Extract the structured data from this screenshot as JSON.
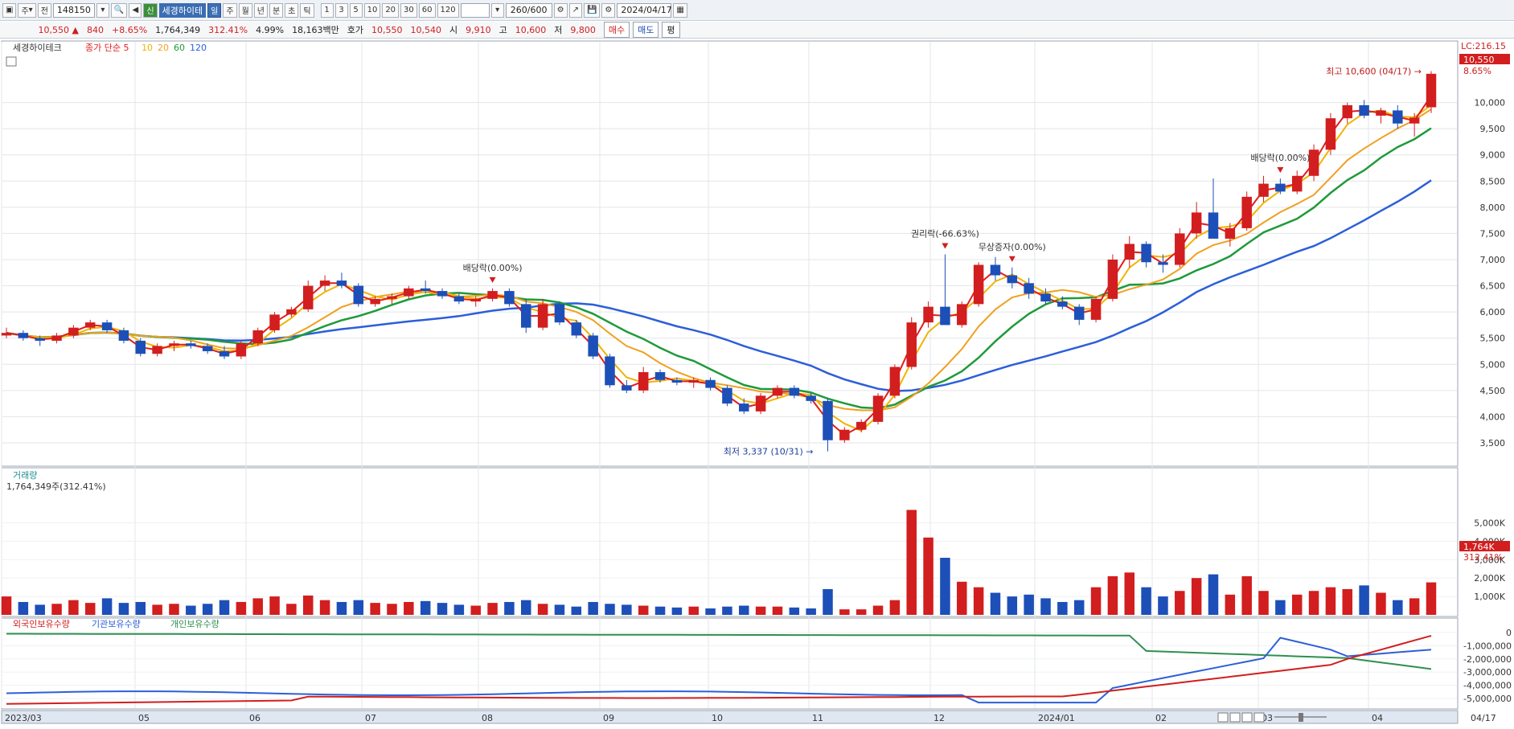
{
  "toolbar": {
    "period": "주",
    "mode": "전",
    "code": "148150",
    "name": "세경하이테",
    "tf_labels": [
      "일",
      "주",
      "월",
      "년",
      "분",
      "초",
      "틱"
    ],
    "tf_selected": "일",
    "num_labels": [
      "1",
      "3",
      "5",
      "10",
      "20",
      "30",
      "60",
      "120"
    ],
    "count": "260/600",
    "date": "2024/04/17"
  },
  "quote": {
    "price": "10,550 ▲",
    "change": "840",
    "change_pct": "+8.65%",
    "volume": "1,764,349",
    "volume_pct": "312.41%",
    "turnover_pct": "4.99%",
    "amount": "18,163백만",
    "hoga_label": "호가",
    "ask": "10,550",
    "bid": "10,540",
    "open_label": "시",
    "open": "9,910",
    "high_label": "고",
    "high": "10,600",
    "low_label": "저",
    "low": "9,800",
    "buy_btn": "매수",
    "sell_btn": "매도",
    "eval_btn": "평"
  },
  "colors": {
    "up": "#d21e1e",
    "down": "#1d4fb8",
    "ma5": "#e31c1c",
    "ma10": "#f0b400",
    "ma20": "#f0a020",
    "ma60": "#1f9a3a",
    "ma120": "#2c5fd8",
    "foreign": "#d21e1e",
    "institution": "#2c5fd8",
    "individual": "#2f8f4f"
  },
  "chart_data": [
    {
      "type": "line",
      "title": "세경하이테크",
      "legend": [
        "종가 단순 5",
        "10",
        "20",
        "60",
        "120"
      ],
      "x_ticks": [
        "2023/03",
        "05",
        "06",
        "07",
        "08",
        "09",
        "10",
        "11",
        "12",
        "2024/01",
        "02",
        "03",
        "04",
        "04/17"
      ],
      "ylim": [
        3100,
        10900
      ],
      "y_ticks": [
        "3,500",
        "4,000",
        "4,500",
        "5,000",
        "5,500",
        "6,000",
        "6,500",
        "7,000",
        "7,500",
        "8,000",
        "8,500",
        "9,000",
        "9,500",
        "10,000"
      ],
      "candles": [
        [
          5550,
          5700,
          5500,
          5600
        ],
        [
          5600,
          5650,
          5450,
          5500
        ],
        [
          5500,
          5550,
          5350,
          5450
        ],
        [
          5450,
          5600,
          5400,
          5550
        ],
        [
          5550,
          5750,
          5500,
          5700
        ],
        [
          5700,
          5850,
          5650,
          5800
        ],
        [
          5800,
          5850,
          5600,
          5650
        ],
        [
          5650,
          5700,
          5400,
          5450
        ],
        [
          5450,
          5500,
          5150,
          5200
        ],
        [
          5200,
          5400,
          5150,
          5350
        ],
        [
          5350,
          5450,
          5250,
          5400
        ],
        [
          5400,
          5450,
          5300,
          5350
        ],
        [
          5350,
          5400,
          5200,
          5250
        ],
        [
          5250,
          5350,
          5100,
          5150
        ],
        [
          5150,
          5450,
          5100,
          5400
        ],
        [
          5400,
          5700,
          5350,
          5650
        ],
        [
          5650,
          6000,
          5600,
          5950
        ],
        [
          5950,
          6100,
          5900,
          6050
        ],
        [
          6050,
          6600,
          6000,
          6500
        ],
        [
          6500,
          6700,
          6400,
          6600
        ],
        [
          6600,
          6750,
          6450,
          6500
        ],
        [
          6500,
          6550,
          6100,
          6150
        ],
        [
          6150,
          6300,
          6100,
          6250
        ],
        [
          6250,
          6350,
          6150,
          6300
        ],
        [
          6300,
          6500,
          6250,
          6450
        ],
        [
          6450,
          6600,
          6350,
          6400
        ],
        [
          6400,
          6450,
          6250,
          6300
        ],
        [
          6300,
          6350,
          6150,
          6200
        ],
        [
          6200,
          6300,
          6100,
          6250
        ],
        [
          6250,
          6450,
          6200,
          6400
        ],
        [
          6400,
          6450,
          6100,
          6150
        ],
        [
          6150,
          6250,
          5600,
          5700
        ],
        [
          5700,
          6250,
          5650,
          6150
        ],
        [
          6150,
          6200,
          5750,
          5800
        ],
        [
          5800,
          5850,
          5500,
          5550
        ],
        [
          5550,
          5600,
          5100,
          5150
        ],
        [
          5150,
          5200,
          4550,
          4600
        ],
        [
          4600,
          4700,
          4450,
          4500
        ],
        [
          4500,
          4950,
          4450,
          4850
        ],
        [
          4850,
          4900,
          4650,
          4700
        ],
        [
          4700,
          4750,
          4600,
          4650
        ],
        [
          4650,
          4750,
          4550,
          4700
        ],
        [
          4700,
          4750,
          4500,
          4550
        ],
        [
          4550,
          4600,
          4200,
          4250
        ],
        [
          4250,
          4350,
          4050,
          4100
        ],
        [
          4100,
          4450,
          4050,
          4400
        ],
        [
          4400,
          4600,
          4350,
          4550
        ],
        [
          4550,
          4600,
          4350,
          4400
        ],
        [
          4400,
          4450,
          4250,
          4300
        ],
        [
          4300,
          4350,
          3337,
          3550
        ],
        [
          3550,
          3800,
          3500,
          3750
        ],
        [
          3750,
          3950,
          3700,
          3900
        ],
        [
          3900,
          4450,
          3850,
          4400
        ],
        [
          4400,
          5000,
          4350,
          4950
        ],
        [
          4950,
          5900,
          4900,
          5800
        ],
        [
          5800,
          6200,
          5700,
          6100
        ],
        [
          6100,
          7100,
          5950,
          5750
        ],
        [
          5750,
          6200,
          5700,
          6150
        ],
        [
          6150,
          6950,
          6100,
          6900
        ],
        [
          6900,
          7050,
          6600,
          6700
        ],
        [
          6700,
          6850,
          6450,
          6550
        ],
        [
          6550,
          6650,
          6250,
          6350
        ],
        [
          6350,
          6450,
          6150,
          6200
        ],
        [
          6200,
          6300,
          6050,
          6100
        ],
        [
          6100,
          6150,
          5750,
          5850
        ],
        [
          5850,
          6300,
          5800,
          6250
        ],
        [
          6250,
          7100,
          6200,
          7000
        ],
        [
          7000,
          7450,
          6850,
          7300
        ],
        [
          7300,
          7350,
          6850,
          6950
        ],
        [
          6950,
          7100,
          6750,
          6900
        ],
        [
          6900,
          7600,
          6850,
          7500
        ],
        [
          7500,
          8100,
          7400,
          7900
        ],
        [
          7900,
          8550,
          7700,
          7400
        ],
        [
          7400,
          7700,
          7250,
          7600
        ],
        [
          7600,
          8300,
          7550,
          8200
        ],
        [
          8200,
          8600,
          8100,
          8450
        ],
        [
          8450,
          8550,
          8250,
          8300
        ],
        [
          8300,
          8700,
          8250,
          8600
        ],
        [
          8600,
          9200,
          8500,
          9100
        ],
        [
          9100,
          9800,
          9000,
          9700
        ],
        [
          9700,
          10000,
          9600,
          9950
        ],
        [
          9950,
          10050,
          9700,
          9750
        ],
        [
          9750,
          9900,
          9600,
          9850
        ],
        [
          9850,
          9950,
          9500,
          9600
        ],
        [
          9600,
          9800,
          9350,
          9710
        ],
        [
          9910,
          10600,
          9800,
          10550
        ]
      ],
      "annotations": [
        {
          "text": "배당락(0.00%)",
          "candle": 29
        },
        {
          "text": "권리락(-66.63%)",
          "candle": 56
        },
        {
          "text": "무상증자(0.00%)",
          "candle": 60
        },
        {
          "text": "배당락(0.00%)",
          "candle": 76
        },
        {
          "text": "최고 10,600 (04/17)",
          "candle": 85
        },
        {
          "text": "최저 3,337 (10/31)",
          "candle": 49
        }
      ],
      "last_price_label": "10,550",
      "last_pct_label": "8.65%",
      "lc_label": "LC:216.15"
    },
    {
      "type": "bar",
      "title": "거래량",
      "subtitle": "1,764,349주(312.41%)",
      "unit": "K",
      "y_ticks": [
        "1,000K",
        "2,000K",
        "3,000K",
        "4,000K",
        "5,000K"
      ],
      "ylim": [
        0,
        5500
      ],
      "volume_k": [
        1000,
        700,
        550,
        600,
        800,
        650,
        900,
        650,
        700,
        550,
        600,
        500,
        600,
        800,
        700,
        900,
        1000,
        600,
        1050,
        800,
        700,
        800,
        650,
        600,
        700,
        750,
        650,
        550,
        500,
        650,
        700,
        800,
        600,
        550,
        450,
        700,
        600,
        550,
        500,
        450,
        400,
        450,
        350,
        450,
        500,
        450,
        450,
        400,
        350,
        1400,
        300,
        300,
        500,
        800,
        5700,
        4200,
        3100,
        1800,
        1500,
        1200,
        1000,
        1100,
        900,
        700,
        800,
        1500,
        2100,
        2300,
        1500,
        1000,
        1300,
        2000,
        2200,
        1100,
        2100,
        1300,
        800,
        1100,
        1300,
        1500,
        1400,
        1600,
        1200,
        800,
        900,
        1764
      ],
      "last_label": "1,764K",
      "last_pct_label": "312.41%"
    },
    {
      "type": "line",
      "title": "외국인보유수량",
      "legend": [
        "외국인보유수량",
        "기관보유수량",
        "개인보유수량"
      ],
      "y_ticks": [
        "0",
        "-1,000,000",
        "-2,000,000",
        "-3,000,000",
        "-4,000,000",
        "-5,000,000"
      ],
      "ylim": [
        -5600000,
        600000
      ]
    }
  ],
  "footer": {
    "controls": [
      "▶",
      "⏮",
      "⏭",
      "■",
      "▷"
    ]
  }
}
